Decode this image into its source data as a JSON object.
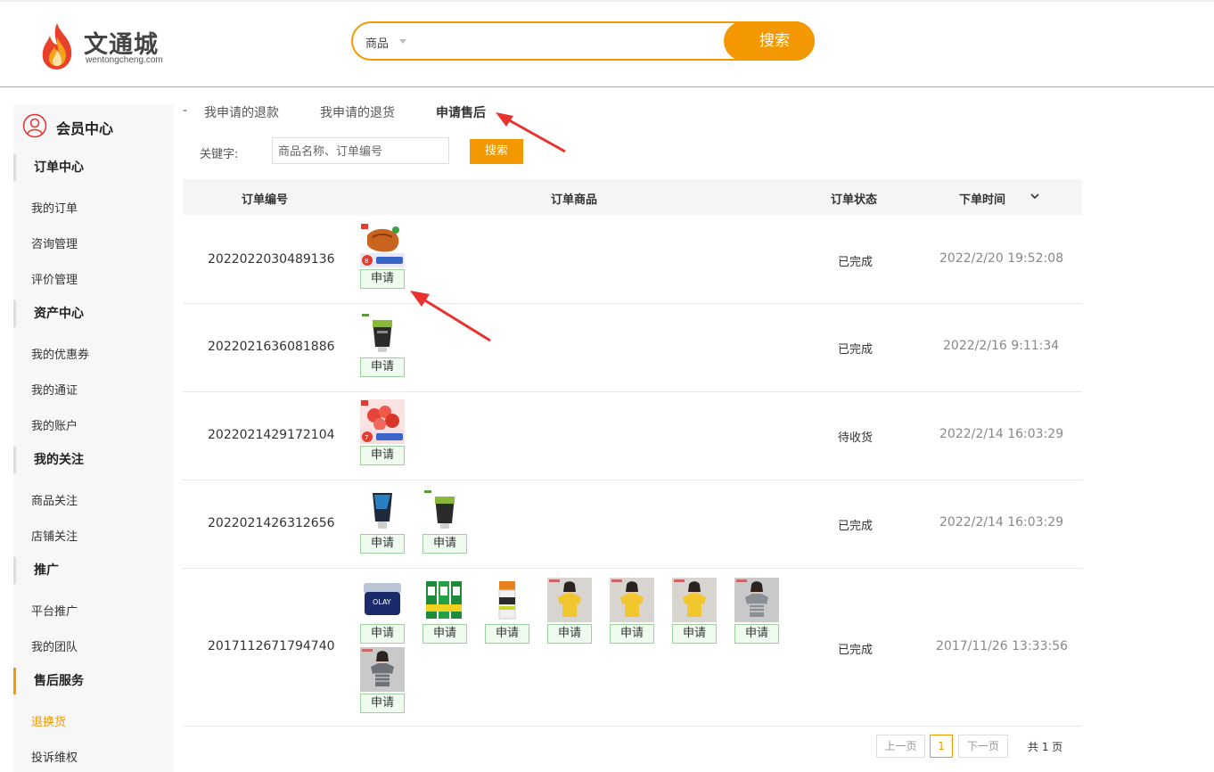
{
  "header": {
    "logo_name": "文通城",
    "logo_sub": "wentongcheng.com",
    "search_type": "商品",
    "search_value": "",
    "search_button": "搜索"
  },
  "sidebar": {
    "title": "会员中心",
    "sections": [
      {
        "label": "订单中心",
        "items": [
          "我的订单",
          "咨询管理",
          "评价管理"
        ]
      },
      {
        "label": "资产中心",
        "items": [
          "我的优惠券",
          "我的通证",
          "我的账户"
        ]
      },
      {
        "label": "我的关注",
        "items": [
          "商品关注",
          "店铺关注"
        ]
      },
      {
        "label": "推广",
        "items": [
          "平台推广",
          "我的团队"
        ]
      },
      {
        "label": "售后服务",
        "items": [
          "退换货",
          "投诉维权"
        ]
      }
    ]
  },
  "tabs": [
    "我申请的退款",
    "我申请的退货",
    "申请售后"
  ],
  "active_tab": "申请售后",
  "filter": {
    "label": "关键字:",
    "placeholder": "商品名称、订单编号",
    "button": "搜索"
  },
  "table": {
    "columns": [
      "订单编号",
      "订单商品",
      "订单状态",
      "下单时间"
    ],
    "apply_label": "申请",
    "rows": [
      {
        "order_no": "2022022030489136",
        "status": "已完成",
        "time": "2022/2/20 19:52:08",
        "products": [
          "snack-package"
        ]
      },
      {
        "order_no": "2022021636081886",
        "status": "已完成",
        "time": "2022/2/16 9:11:34",
        "products": [
          "facial-cleanser-green"
        ]
      },
      {
        "order_no": "2022021429172104",
        "status": "待收货",
        "time": "2022/2/14 16:03:29",
        "products": [
          "fruit-candy-package"
        ]
      },
      {
        "order_no": "2022021426312656",
        "status": "已完成",
        "time": "2022/2/14 16:03:29",
        "products": [
          "facial-cleanser-blue",
          "facial-cleanser-green"
        ]
      },
      {
        "order_no": "2017112671794740",
        "status": "已完成",
        "time": "2017/11/26 13:33:56",
        "products": [
          "olay-cream-jar",
          "toothpaste-pack",
          "lotion-bottle",
          "yellow-tshirt",
          "yellow-tshirt",
          "yellow-tshirt",
          "gray-tshirt",
          "gray-tshirt-2"
        ]
      }
    ]
  },
  "pagination": {
    "prev": "上一页",
    "current": "1",
    "next": "下一页",
    "total": "共 1 页"
  },
  "colors": {
    "accent": "#f39800",
    "annotation_arrow": "#e8322f"
  }
}
